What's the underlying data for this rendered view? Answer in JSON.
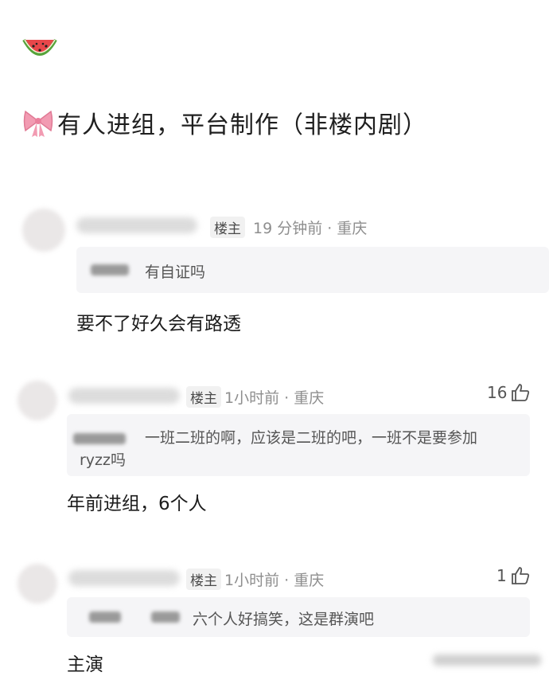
{
  "post": {
    "emoji": "watermelon",
    "bow_emoji": "ribbon-bow",
    "text": "有人进组，平台制作（非楼内剧）"
  },
  "comments": [
    {
      "op_tag": "楼主",
      "meta": "19 分钟前 · 重庆",
      "quote_text": "有自证吗",
      "text": "要不了好久会有路透",
      "likes": ""
    },
    {
      "op_tag": "楼主",
      "meta": "1小时前 · 重庆",
      "quote_text": "一班二班的啊，应该是二班的吧，一班不是要参加",
      "quote_text_2": "ryzz吗",
      "text": "年前进组，6个人",
      "likes": "16"
    },
    {
      "op_tag": "楼主",
      "meta": "1小时前 · 重庆",
      "quote_text": "六个人好搞笑，这是群演吧",
      "text": "主演",
      "likes": "1"
    }
  ],
  "icons": {
    "like": "thumbs-up-icon"
  }
}
